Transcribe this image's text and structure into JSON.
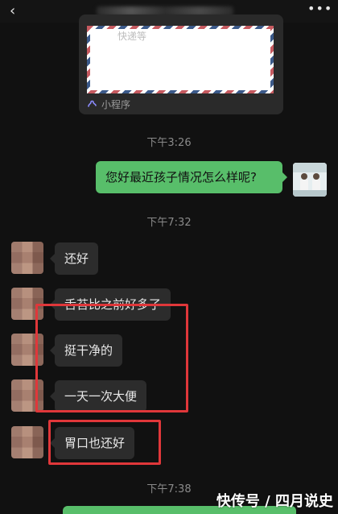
{
  "header": {
    "back_icon": "chevron-left-icon",
    "more_icon": "more-dots-icon"
  },
  "mini_program_card": {
    "preview_text": "快递等",
    "footer_label": "小程序",
    "footer_icon": "mini-program-icon"
  },
  "messages": {
    "time1": "下午3:26",
    "outgoing1": "您好最近孩子情况怎么样呢?",
    "time2": "下午7:32",
    "incoming": [
      "还好",
      "舌苔比之前好多了",
      "挺干净的",
      "一天一次大便",
      "胃口也还好"
    ],
    "time3": "下午7:38"
  },
  "watermark": "快传号 / 四月说史",
  "colors": {
    "background": "#111111",
    "outgoing_bubble": "#58be6a",
    "incoming_bubble": "#2c2c2c",
    "annotation": "#e0373a"
  }
}
